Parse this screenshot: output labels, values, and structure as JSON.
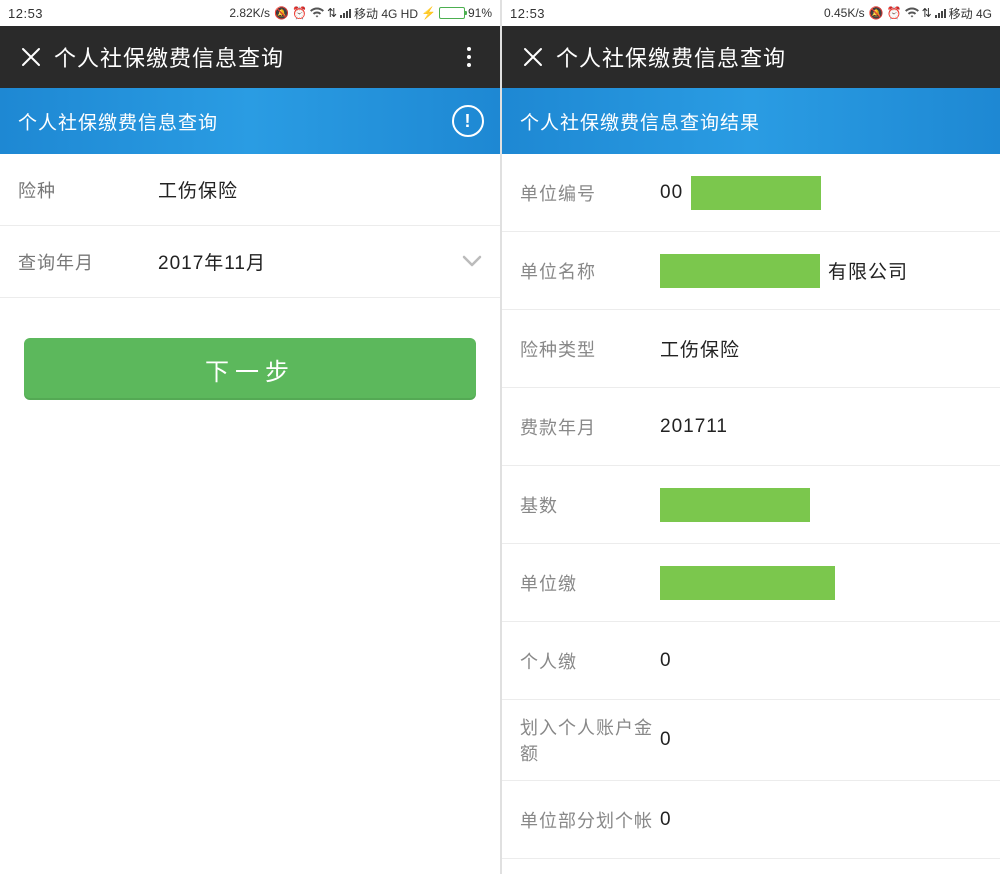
{
  "left": {
    "status": {
      "time": "12:53",
      "speed": "2.82K/s",
      "carrier": "移动 4G HD",
      "battery_pct": "91%",
      "battery_fill_pct": 91
    },
    "titlebar": {
      "title": "个人社保缴费信息查询"
    },
    "banner": {
      "title": "个人社保缴费信息查询"
    },
    "form": {
      "insurance_label": "险种",
      "insurance_value": "工伤保险",
      "period_label": "查询年月",
      "period_value": "2017年11月"
    },
    "next_button": "下一步"
  },
  "right": {
    "status": {
      "time": "12:53",
      "speed": "0.45K/s",
      "carrier": "移动 4G"
    },
    "titlebar": {
      "title": "个人社保缴费信息查询"
    },
    "banner": {
      "title": "个人社保缴费信息查询结果"
    },
    "rows": {
      "unit_no_label": "单位编号",
      "unit_no_prefix": "00",
      "unit_name_label": "单位名称",
      "unit_name_suffix": "有限公司",
      "ins_type_label": "险种类型",
      "ins_type_value": "工伤保险",
      "period_label": "费款年月",
      "period_value": "201711",
      "base_label": "基数",
      "unit_pay_label": "单位缴",
      "personal_pay_label": "个人缴",
      "personal_pay_value": "0",
      "to_personal_label": "划入个人账户金额",
      "to_personal_value": "0",
      "unit_to_acct_label": "单位部分划个帐",
      "unit_to_acct_value": "0"
    }
  }
}
